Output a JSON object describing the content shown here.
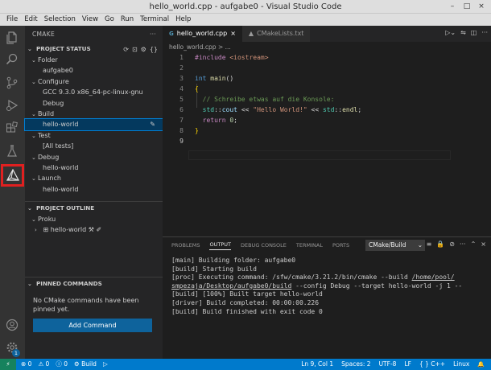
{
  "window": {
    "title": "hello_world.cpp - aufgabe0 - Visual Studio Code",
    "minimize": "–",
    "restore": "□",
    "close": "×"
  },
  "menu": [
    "File",
    "Edit",
    "Selection",
    "View",
    "Go",
    "Run",
    "Terminal",
    "Help"
  ],
  "activity": [
    "files-icon",
    "search-icon",
    "source-control-icon",
    "run-debug-icon",
    "extensions-icon",
    "testing-icon",
    "cmake-icon",
    "account-icon",
    "settings-gear-icon"
  ],
  "settings_badge": "1",
  "sidebar": {
    "title": "CMAKE",
    "more": "···",
    "project_status": {
      "header": "PROJECT STATUS",
      "folder_label": "Folder",
      "folder_value": "aufgabe0",
      "configure_label": "Configure",
      "configure_kit": "GCC 9.3.0 x86_64-pc-linux-gnu",
      "configure_variant": "Debug",
      "build_label": "Build",
      "build_target": "hello-world",
      "test_label": "Test",
      "test_value": "[All tests]",
      "debug_label": "Debug",
      "debug_target": "hello-world",
      "launch_label": "Launch",
      "launch_target": "hello-world"
    },
    "project_outline": {
      "header": "PROJECT OUTLINE",
      "project": "Proku",
      "target": "hello-world"
    },
    "pinned": {
      "header": "PINNED COMMANDS",
      "empty_text": "No CMake commands have been pinned yet.",
      "add_button": "Add Command"
    }
  },
  "editor": {
    "tabs": [
      {
        "label": "hello_world.cpp"
      },
      {
        "label": "CMakeLists.txt"
      }
    ],
    "close_icon": "×",
    "breadcrumb": "hello_world.cpp > ...",
    "lines": [
      "1",
      "2",
      "3",
      "4",
      "5",
      "6",
      "7",
      "8",
      "9"
    ],
    "code": {
      "l1a": "#include ",
      "l1b": "<iostream>",
      "l3a": "int",
      "l3b": " main",
      "l3c": "()",
      "l4": "{",
      "l5": "  // Schreibe etwas auf die Konsole:",
      "l6a": "  std",
      "l6b": "::",
      "l6c": "cout",
      "l6d": " << ",
      "l6e": "\"Hello World!\"",
      "l6f": " << ",
      "l6g": "std",
      "l6h": "::",
      "l6i": "endl",
      "l6j": ";",
      "l7a": "  return",
      "l7b": " 0",
      "l7c": ";",
      "l8": "}"
    }
  },
  "panel": {
    "tabs": [
      "PROBLEMS",
      "OUTPUT",
      "DEBUG CONSOLE",
      "TERMINAL",
      "PORTS"
    ],
    "channel": "CMake/Build",
    "output": {
      "o1": "[main] Building folder: aufgabe0",
      "o2": "[build] Starting build",
      "o3a": "[proc] Executing command: /sfw/cmake/3.21.2/bin/cmake --build ",
      "o3b": "/home/pool/",
      "o4a": "smpezaja/Desktop/aufgabe0/build",
      "o4b": " --config Debug --target hello-world -j 1 --",
      "o5": "[build] [100%] Built target hello-world",
      "o6": "[driver] Build completed: 00:00:00.226",
      "o7": "[build] Build finished with exit code 0"
    }
  },
  "status": {
    "errors": "⊗ 0",
    "warnings": "⚠ 0",
    "info": "ⓘ 0",
    "build": "⚙ Build",
    "play": "▷",
    "position": "Ln 9, Col 1",
    "spaces": "Spaces: 2",
    "encoding": "UTF-8",
    "eol": "LF",
    "lang": "{ } C++",
    "platform": "Linux",
    "bell": "🔔"
  }
}
